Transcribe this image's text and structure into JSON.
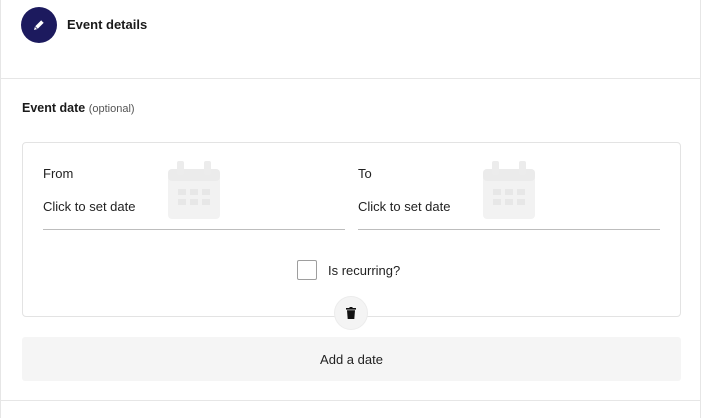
{
  "header": {
    "title": "Event details",
    "icon": "pencil-icon",
    "icon_bg": "#1c1a5e"
  },
  "event_date": {
    "label": "Event date",
    "optional": "(optional)",
    "from": {
      "label": "From",
      "value": "Click to set date",
      "icon": "calendar-icon"
    },
    "to": {
      "label": "To",
      "value": "Click to set date",
      "icon": "calendar-icon"
    },
    "recurring": {
      "label": "Is recurring?",
      "checked": false
    },
    "delete_icon": "trash-icon",
    "add_label": "Add a date"
  }
}
